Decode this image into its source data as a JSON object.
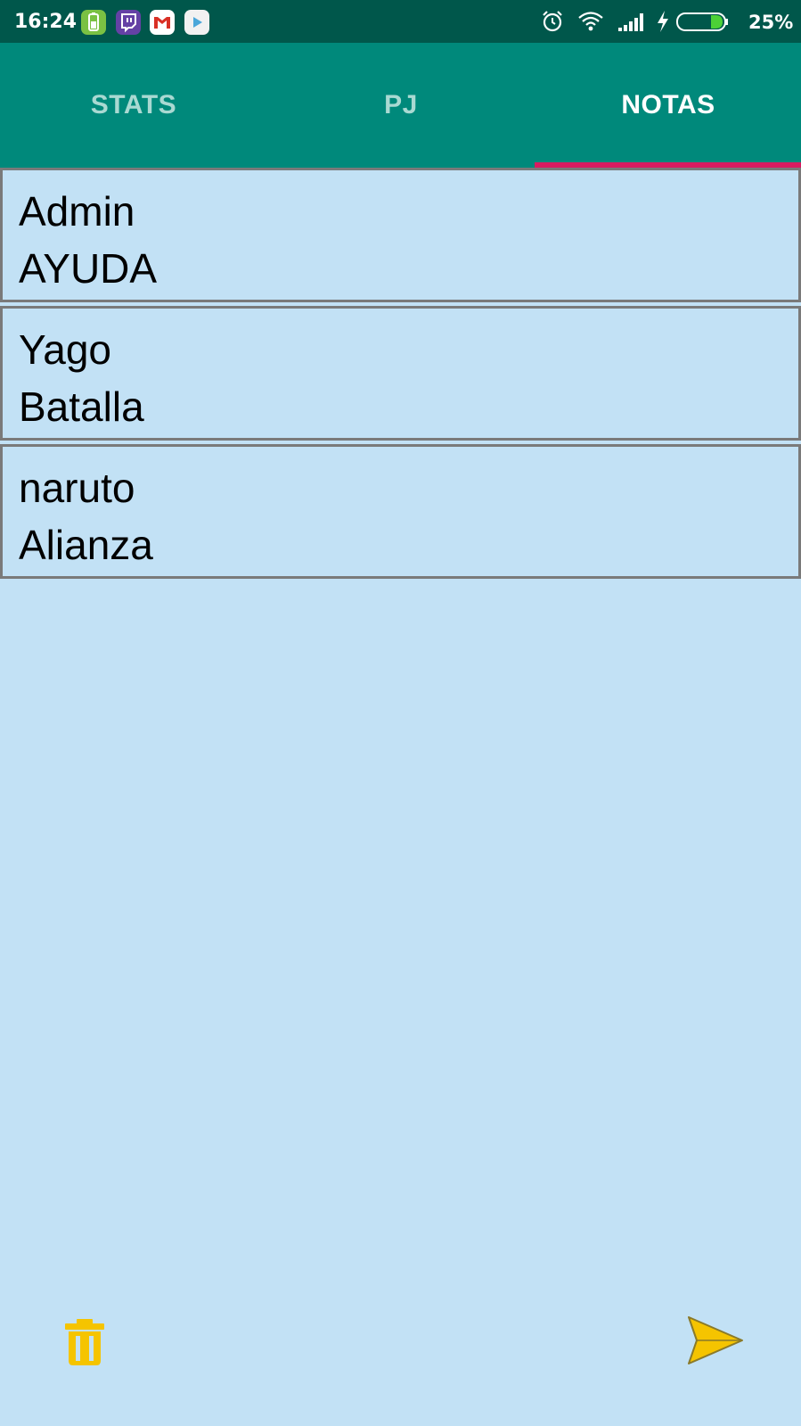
{
  "status_bar": {
    "time": "16:24",
    "battery_percent": "25%",
    "notification_icons": [
      "battery-app-icon",
      "twitch-icon",
      "gmail-icon",
      "play-store-icon"
    ],
    "system_icons": [
      "alarm-icon",
      "wifi-icon",
      "signal-icon",
      "charging-icon",
      "battery-icon"
    ],
    "battery_level": 0.25
  },
  "tabs": [
    {
      "label": "STATS",
      "active": false
    },
    {
      "label": "PJ",
      "active": false
    },
    {
      "label": "NOTAS",
      "active": true
    }
  ],
  "notes": [
    {
      "title": "Admin",
      "subtitle": "AYUDA"
    },
    {
      "title": "Yago",
      "subtitle": "Batalla"
    },
    {
      "title": "naruto",
      "subtitle": "Alianza"
    }
  ],
  "bottom_actions": {
    "trash_icon": "trash-icon",
    "send_icon": "send-icon"
  },
  "colors": {
    "status_bar": "#00574b",
    "tab_bar": "#00897b",
    "tab_indicator": "#d81b60",
    "background": "#c2e1f5",
    "icon_accent": "#f5c400"
  }
}
